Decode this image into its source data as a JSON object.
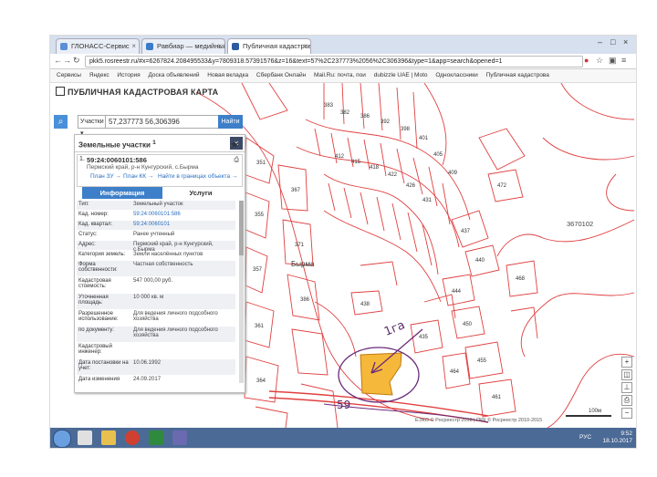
{
  "browser": {
    "tabs": [
      {
        "label": "ГЛОНАСС-Сервис",
        "color": "#5b8fd6"
      },
      {
        "label": "Равбиар — медийный",
        "color": "#3a7ac8"
      },
      {
        "label": "Публичная кадастровая",
        "color": "#2d5aa0"
      }
    ],
    "address": "pkk5.rosreestr.ru/#x=6267824.208495533&y=7809318.57391576&z=16&text=57%2C237773%2056%2C306396&type=1&app=search&opened=1",
    "bookmarks": [
      "Сервисы",
      "Яндекс",
      "История",
      "Доска объявлений",
      "Новая вкладка",
      "Сбербанк Онлайн",
      "Mail.Ru: почта, пои",
      "dubizzle UAE | Moto",
      "Одноклассники",
      "Публичная кадастрова"
    ]
  },
  "app": {
    "title": "ПУБЛИЧНАЯ КАДАСТРОВАЯ КАРТА",
    "search": {
      "type": "Участки",
      "value": "57,237773 56,306396",
      "button": "Найти"
    },
    "panel": {
      "heading": "Земельные участки",
      "heading_count": "1",
      "object": {
        "num": "1.",
        "id": "59:24:0060101:586",
        "address": "Пермский край, р-н Кунгурский, с.Бырма",
        "link_plan_zu": "План ЗУ →",
        "link_plan_kk": "План КК →",
        "link_borders": "Найти в границах объекта →"
      },
      "tab_info": "Информация",
      "tab_services": "Услуги",
      "rows": [
        {
          "k": "Тип:",
          "v": "Земельный участок",
          "link": false
        },
        {
          "k": "Кад. номер:",
          "v": "59:24:0060101:586",
          "link": true
        },
        {
          "k": "Кад. квартал:",
          "v": "59:24:0060101",
          "link": true
        },
        {
          "k": "Статус:",
          "v": "Ранее учтенный",
          "link": false
        },
        {
          "k": "Адрес:",
          "v": "Пермский край, р-н Кунгурский, с.Бырма",
          "link": false
        },
        {
          "k": "Категория земель:",
          "v": "Земли населённых пунктов",
          "link": false
        },
        {
          "k": "Форма собственности:",
          "v": "Частная собственность",
          "link": false
        },
        {
          "k": "Кадастровая стоимость:",
          "v": "547 000,00 руб.",
          "link": false
        },
        {
          "k": "Уточненная площадь:",
          "v": "10 000 кв. м",
          "link": false
        },
        {
          "k": "Разрешенное использование:",
          "v": "Для ведения личного подсобного хозяйства",
          "link": false
        },
        {
          "k": "по документу:",
          "v": "Для ведения личного подсобного хозяйства",
          "link": false
        },
        {
          "k": "Кадастровый инженер:",
          "v": "",
          "link": false
        },
        {
          "k": "Дата постановки на учет:",
          "v": "10.06.1992",
          "link": false
        },
        {
          "k": "Дата изменения",
          "v": "24.09.2017",
          "link": false
        }
      ]
    },
    "map": {
      "village_label": "Бырма",
      "quarter_label": "3670102",
      "parcel_labels": [
        "383",
        "382",
        "386",
        "392",
        "398",
        "401",
        "405",
        "409",
        "412",
        "415",
        "418",
        "422",
        "426",
        "431",
        "437",
        "440",
        "444",
        "450",
        "455",
        "461",
        "464",
        "468",
        "472",
        "351",
        "355",
        "357",
        "361",
        "364",
        "367",
        "371",
        "386",
        "435",
        "438"
      ],
      "handwritten_area": "1га",
      "handwritten_59": "59",
      "scale_label": "100м",
      "copyright": "ЕЭКО © Росреестр 2010 | ПКК © Росреестр 2010-2015"
    }
  },
  "taskbar": {
    "lang": "РУС",
    "time": "9:52",
    "date": "18.10.2017"
  },
  "colors": {
    "accent": "#3d7fc9",
    "parcel_line": "#e04040",
    "selected_parcel": "#f5b83a"
  }
}
